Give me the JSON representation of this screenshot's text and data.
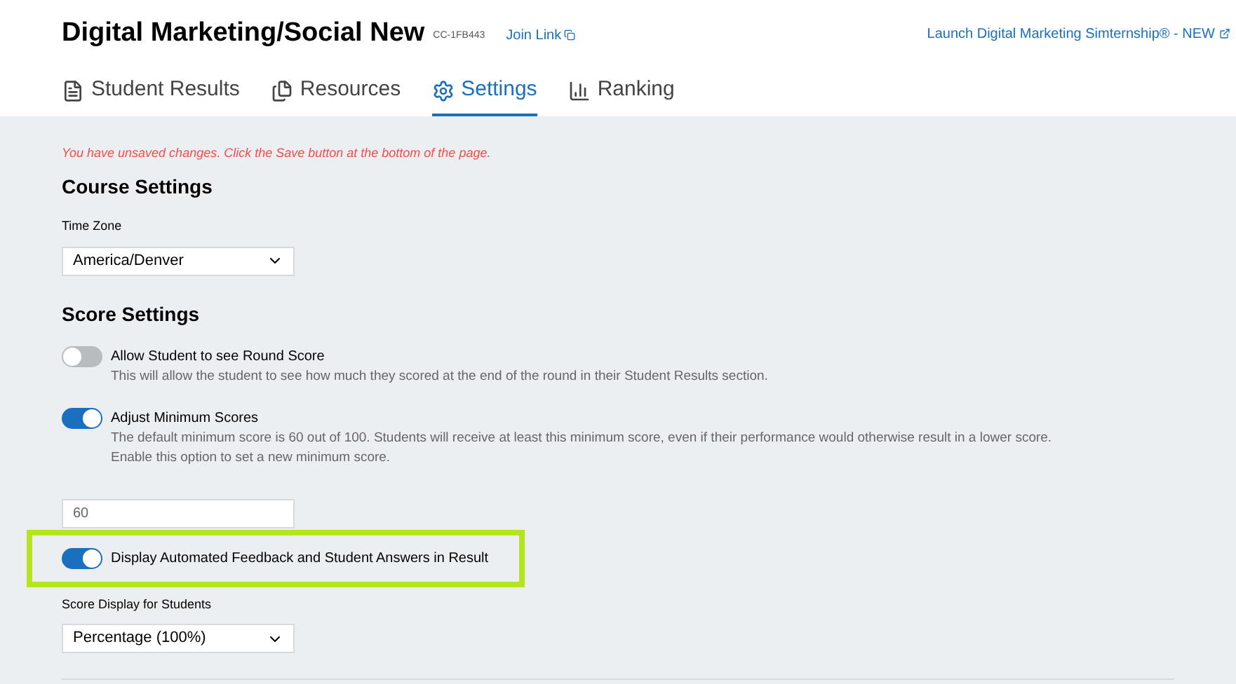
{
  "header": {
    "title": "Digital Marketing/Social New",
    "code": "CC-1FB443",
    "join_link": "Join Link",
    "launch_link": "Launch Digital Marketing Simternship® - NEW"
  },
  "tabs": [
    {
      "label": "Student Results",
      "kind": "results",
      "selected": false
    },
    {
      "label": "Resources",
      "kind": "resources",
      "selected": false
    },
    {
      "label": "Settings",
      "kind": "settings",
      "selected": true
    },
    {
      "label": "Ranking",
      "kind": "ranking",
      "selected": false
    }
  ],
  "warning": "You have unsaved changes. Click the Save button at the bottom of the page.",
  "course_settings": {
    "heading": "Course Settings",
    "time_zone": {
      "label": "Time Zone",
      "value": "America/Denver"
    }
  },
  "score_settings": {
    "heading": "Score Settings",
    "items": [
      {
        "kind": "toggle",
        "label": "Allow Student to see Round Score",
        "on": false,
        "highlighted": false,
        "description": [
          "This will allow the student to see how much they scored at the end of the round in their Student Results section."
        ]
      },
      {
        "kind": "toggle",
        "label": "Adjust Minimum Scores",
        "on": true,
        "highlighted": false,
        "description": [
          "The default minimum score is 60 out of 100. Students will receive at least this minimum score, even if their performance would otherwise result in a lower score.",
          "Enable this option to set a new minimum score."
        ]
      },
      {
        "kind": "field",
        "value": "60"
      },
      {
        "kind": "toggle",
        "label": "Display Automated Feedback and Student Answers in Result",
        "on": true,
        "highlighted": true
      },
      {
        "kind": "select",
        "label": "Score Display for Students",
        "value": "Percentage (100%)"
      }
    ]
  }
}
